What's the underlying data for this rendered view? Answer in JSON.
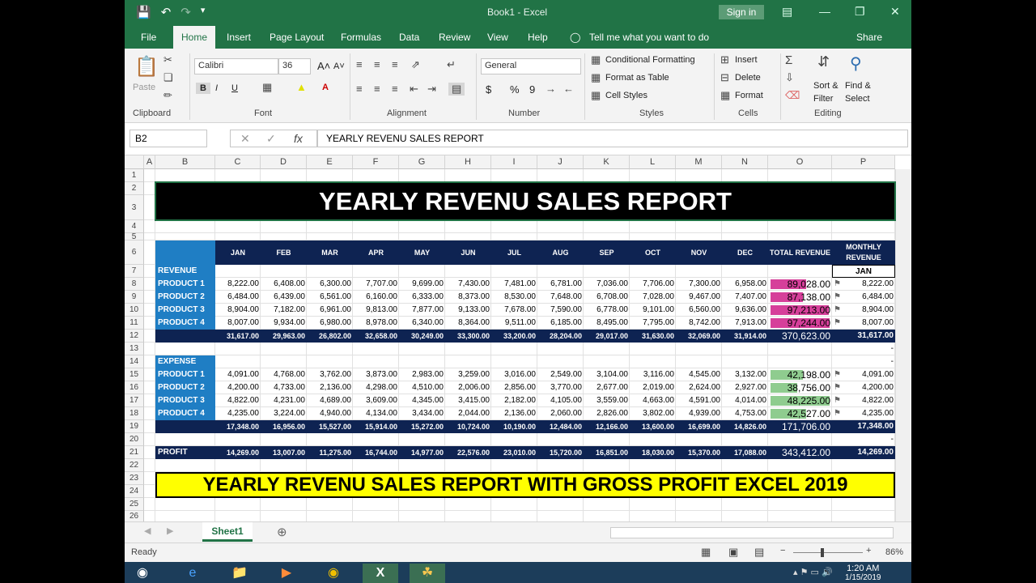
{
  "titlebar": {
    "title": "Book1  -  Excel",
    "signin": "Sign in"
  },
  "tabs": [
    "File",
    "Home",
    "Insert",
    "Page Layout",
    "Formulas",
    "Data",
    "Review",
    "View",
    "Help"
  ],
  "tell_me": "Tell me what you want to do",
  "share": "Share",
  "ribbon": {
    "clipboard": {
      "label": "Clipboard",
      "paste": "Paste"
    },
    "font": {
      "label": "Font",
      "name": "Calibri",
      "size": "36"
    },
    "alignment": {
      "label": "Alignment"
    },
    "number": {
      "label": "Number",
      "format": "General"
    },
    "styles": {
      "label": "Styles",
      "conditional": "Conditional Formatting",
      "table": "Format as Table",
      "cell": "Cell Styles"
    },
    "cells": {
      "label": "Cells",
      "insert": "Insert",
      "delete": "Delete",
      "format": "Format"
    },
    "editing": {
      "label": "Editing",
      "sort": "Sort &",
      "filter": "Filter",
      "find": "Find &",
      "select": "Select"
    }
  },
  "formula_bar": {
    "namebox": "B2",
    "content": "YEARLY REVENU SALES REPORT"
  },
  "columns": [
    "A",
    "B",
    "C",
    "D",
    "E",
    "F",
    "G",
    "H",
    "I",
    "J",
    "K",
    "L",
    "M",
    "N",
    "O",
    "P"
  ],
  "rows": [
    "1",
    "2",
    "3",
    "4",
    "5",
    "6",
    "7",
    "8",
    "9",
    "10",
    "11",
    "12",
    "13",
    "14",
    "15",
    "16",
    "17",
    "18",
    "19",
    "20",
    "21",
    "22",
    "23",
    "24",
    "25",
    "26"
  ],
  "sheet": {
    "title": "YEARLY REVENU SALES REPORT",
    "months": [
      "JAN",
      "FEB",
      "MAR",
      "APR",
      "MAY",
      "JUN",
      "JUL",
      "AUG",
      "SEP",
      "OCT",
      "NOV",
      "DEC"
    ],
    "total_revenue_header": "TOTAL REVENUE",
    "monthly_revenue_header": "MONTHLY REVENUE",
    "monthly_selected": "JAN",
    "revenue_label": "REVENUE",
    "expense_label": "EXPENSE",
    "profit_label": "PROFIT",
    "revenue_rows": [
      {
        "name": "PRODUCT 1",
        "values": [
          "8,222.00",
          "6,408.00",
          "6,300.00",
          "7,707.00",
          "9,699.00",
          "7,430.00",
          "7,481.00",
          "6,781.00",
          "7,036.00",
          "7,706.00",
          "7,300.00",
          "6,958.00"
        ],
        "total": "89,028.00",
        "monthly": "8,222.00"
      },
      {
        "name": "PRODUCT 2",
        "values": [
          "6,484.00",
          "6,439.00",
          "6,561.00",
          "6,160.00",
          "6,333.00",
          "8,373.00",
          "8,530.00",
          "7,648.00",
          "6,708.00",
          "7,028.00",
          "9,467.00",
          "7,407.00"
        ],
        "total": "87,138.00",
        "monthly": "6,484.00"
      },
      {
        "name": "PRODUCT 3",
        "values": [
          "8,904.00",
          "7,182.00",
          "6,961.00",
          "9,813.00",
          "7,877.00",
          "9,133.00",
          "7,678.00",
          "7,590.00",
          "6,778.00",
          "9,101.00",
          "6,560.00",
          "9,636.00"
        ],
        "total": "97,213.00",
        "monthly": "8,904.00"
      },
      {
        "name": "PRODUCT 4",
        "values": [
          "8,007.00",
          "9,934.00",
          "6,980.00",
          "8,978.00",
          "6,340.00",
          "8,364.00",
          "9,511.00",
          "6,185.00",
          "8,495.00",
          "7,795.00",
          "8,742.00",
          "7,913.00"
        ],
        "total": "97,244.00",
        "monthly": "8,007.00"
      }
    ],
    "revenue_total": {
      "values": [
        "31,617.00",
        "29,963.00",
        "26,802.00",
        "32,658.00",
        "30,249.00",
        "33,300.00",
        "33,200.00",
        "28,204.00",
        "29,017.00",
        "31,630.00",
        "32,069.00",
        "31,914.00"
      ],
      "total": "370,623.00",
      "monthly": "31,617.00"
    },
    "expense_rows": [
      {
        "name": "PRODUCT 1",
        "values": [
          "4,091.00",
          "4,768.00",
          "3,762.00",
          "3,873.00",
          "2,983.00",
          "3,259.00",
          "3,016.00",
          "2,549.00",
          "3,104.00",
          "3,116.00",
          "4,545.00",
          "3,132.00"
        ],
        "total": "42,198.00",
        "monthly": "4,091.00"
      },
      {
        "name": "PRODUCT 2",
        "values": [
          "4,200.00",
          "4,733.00",
          "2,136.00",
          "4,298.00",
          "4,510.00",
          "2,006.00",
          "2,856.00",
          "3,770.00",
          "2,677.00",
          "2,019.00",
          "2,624.00",
          "2,927.00"
        ],
        "total": "38,756.00",
        "monthly": "4,200.00"
      },
      {
        "name": "PRODUCT 3",
        "values": [
          "4,822.00",
          "4,231.00",
          "4,689.00",
          "3,609.00",
          "4,345.00",
          "3,415.00",
          "2,182.00",
          "4,105.00",
          "3,559.00",
          "4,663.00",
          "4,591.00",
          "4,014.00"
        ],
        "total": "48,225.00",
        "monthly": "4,822.00"
      },
      {
        "name": "PRODUCT 4",
        "values": [
          "4,235.00",
          "3,224.00",
          "4,940.00",
          "4,134.00",
          "3,434.00",
          "2,044.00",
          "2,136.00",
          "2,060.00",
          "2,826.00",
          "3,802.00",
          "4,939.00",
          "4,753.00"
        ],
        "total": "42,527.00",
        "monthly": "4,235.00"
      }
    ],
    "expense_total": {
      "values": [
        "17,348.00",
        "16,956.00",
        "15,527.00",
        "15,914.00",
        "15,272.00",
        "10,724.00",
        "10,190.00",
        "12,484.00",
        "12,166.00",
        "13,600.00",
        "16,699.00",
        "14,826.00"
      ],
      "total": "171,706.00",
      "monthly": "17,348.00"
    },
    "profit": {
      "values": [
        "14,269.00",
        "13,007.00",
        "11,275.00",
        "16,744.00",
        "14,977.00",
        "22,576.00",
        "23,010.00",
        "15,720.00",
        "16,851.00",
        "18,030.00",
        "15,370.00",
        "17,088.00"
      ],
      "total": "343,412.00",
      "monthly": "14,269.00"
    },
    "dash": "-",
    "banner": "YEARLY REVENU SALES REPORT WITH GROSS PROFIT EXCEL 2019",
    "bar_fill": {
      "revenue": [
        0.6,
        0.55,
        0.98,
        1.0
      ],
      "expense": [
        0.55,
        0.45,
        1.0,
        0.6
      ]
    }
  },
  "sheet_tabs": [
    "Sheet1"
  ],
  "status": {
    "ready": "Ready",
    "zoom": "86%"
  },
  "clock": {
    "time": "1:20 AM",
    "date": "1/15/2019"
  },
  "colors": {
    "excel_green": "#217346",
    "header_navy": "#0e2352",
    "label_blue": "#1f7ec4",
    "banner_yellow": "#ffff00",
    "revenue_bar": "#d63f9a",
    "expense_bar": "#8fcc8f"
  }
}
